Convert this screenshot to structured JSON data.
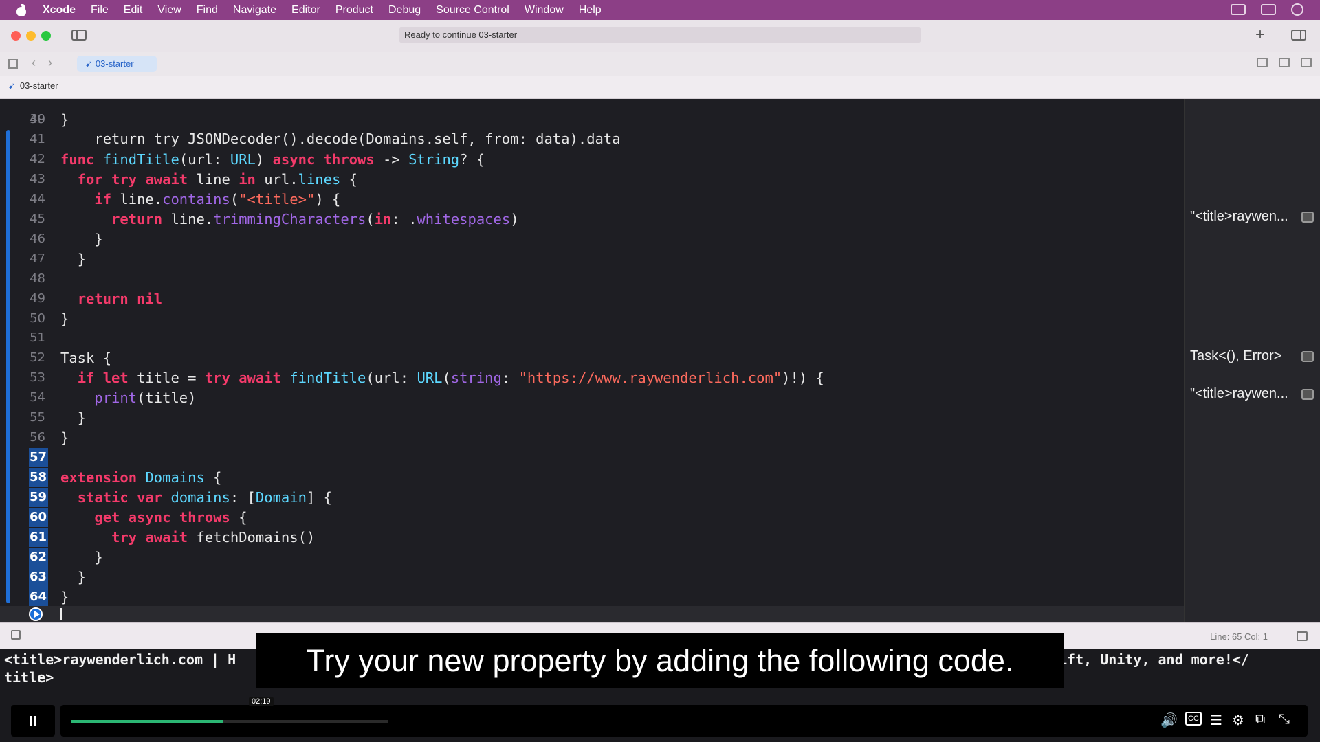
{
  "menubar": {
    "app_name": "Xcode",
    "items": [
      "File",
      "Edit",
      "View",
      "Find",
      "Navigate",
      "Editor",
      "Product",
      "Debug",
      "Source Control",
      "Window",
      "Help"
    ]
  },
  "toolbar": {
    "activity_status": "Ready to continue 03-starter"
  },
  "tabbar": {
    "active_tab": "03-starter"
  },
  "breadcrumb": {
    "file": "03-starter"
  },
  "editor": {
    "partial_top_line": "    return try JSONDecoder().decode(Domains.self, from: data).data",
    "lines": [
      {
        "num": "40",
        "text": "}"
      },
      {
        "num": "41",
        "text": ""
      },
      {
        "num": "42",
        "text": "func findTitle(url: URL) async throws -> String? {"
      },
      {
        "num": "43",
        "text": "  for try await line in url.lines {"
      },
      {
        "num": "44",
        "text": "    if line.contains(\"<title>\") {"
      },
      {
        "num": "45",
        "text": "      return line.trimmingCharacters(in: .whitespaces)"
      },
      {
        "num": "46",
        "text": "    }"
      },
      {
        "num": "47",
        "text": "  }"
      },
      {
        "num": "48",
        "text": ""
      },
      {
        "num": "49",
        "text": "  return nil"
      },
      {
        "num": "50",
        "text": "}"
      },
      {
        "num": "51",
        "text": ""
      },
      {
        "num": "52",
        "text": "Task {"
      },
      {
        "num": "53",
        "text": "  if let title = try await findTitle(url: URL(string: \"https://www.raywenderlich.com\")!) {"
      },
      {
        "num": "54",
        "text": "    print(title)"
      },
      {
        "num": "55",
        "text": "  }"
      },
      {
        "num": "56",
        "text": "}"
      },
      {
        "num": "57",
        "text": ""
      },
      {
        "num": "58",
        "text": "extension Domains {"
      },
      {
        "num": "59",
        "text": "  static var domains: [Domain] {"
      },
      {
        "num": "60",
        "text": "    get async throws {"
      },
      {
        "num": "61",
        "text": "      try await fetchDomains()"
      },
      {
        "num": "62",
        "text": "    }"
      },
      {
        "num": "63",
        "text": "  }"
      },
      {
        "num": "64",
        "text": "}"
      }
    ],
    "selected_line_numbers": [
      "57",
      "58",
      "59",
      "60",
      "61",
      "62",
      "63",
      "64"
    ]
  },
  "results": {
    "line45": "\"<title>raywen...",
    "line52": "Task<(), Error>",
    "line54": "\"<title>raywen..."
  },
  "debugbar": {
    "line_col": "Line: 65  Col: 1"
  },
  "console": {
    "output_start": "<title>raywenderlich.com | H",
    "output_end": "ift, Unity, and more!</",
    "output_line2": "title>"
  },
  "caption": {
    "text": "Try your new property by adding the following code."
  },
  "player": {
    "time": "02:19",
    "progress_fraction": 0.48
  },
  "colors": {
    "menubar": "#8c3f86",
    "keyword": "#f33a6a",
    "type": "#5dd8ff",
    "function": "#a167e6",
    "string": "#fc6a5d",
    "selection": "#1b4f99",
    "progress": "#2bb673"
  },
  "icons": [
    "apple-icon",
    "sidebar-icon",
    "plus-icon",
    "inspector-icon",
    "grid-icon",
    "chevron-left-icon",
    "chevron-right-icon",
    "swift-icon",
    "run-icon",
    "pause-icon",
    "volume-icon",
    "cc-icon",
    "settings-icon",
    "pip-icon",
    "fullscreen-exit-icon"
  ]
}
